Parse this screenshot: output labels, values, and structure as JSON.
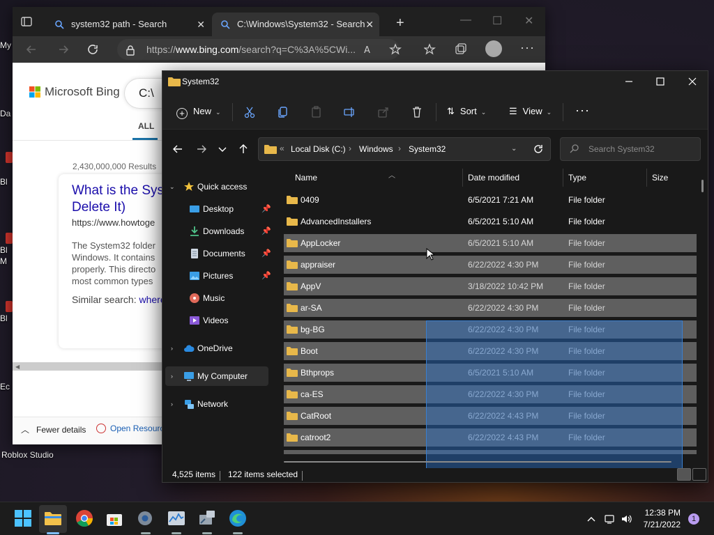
{
  "desktop": {
    "labels": [
      "My",
      "Da",
      "Bl",
      "Bl",
      "M",
      "Bl",
      "Ec",
      "Roblox Studio"
    ]
  },
  "browser": {
    "tabs": [
      {
        "title": "system32 path - Search",
        "active": false
      },
      {
        "title": "C:\\Windows\\System32 - Search",
        "active": true
      }
    ],
    "address_prefix": "https://",
    "address_domain": "www.bing.com",
    "address_rest": "/search?q=C%3A%5CWi...",
    "bing_name": "Microsoft Bing",
    "search_value": "C:\\",
    "tab_all": "ALL",
    "results_count": "2,430,000,000 Results",
    "result_title": "What is the Sys Delete It)",
    "result_url": "https://www.howtoge",
    "result_snippet": "The System32 folder Windows. It contains properly. This directo most common types",
    "similar_label": "Similar search:",
    "similar_link": "where",
    "fewer_details": "Fewer details",
    "open_resource": "Open Resourc"
  },
  "explorer": {
    "title": "System32",
    "commands": {
      "new": "New",
      "sort": "Sort",
      "view": "View"
    },
    "path": [
      "Local Disk (C:)",
      "Windows",
      "System32"
    ],
    "path_prefix": "«",
    "search_placeholder": "Search System32",
    "sidebar": {
      "quick_access": "Quick access",
      "items": [
        {
          "label": "Desktop",
          "icon": "desktop-icon",
          "pinned": true
        },
        {
          "label": "Downloads",
          "icon": "download-icon",
          "pinned": true
        },
        {
          "label": "Documents",
          "icon": "document-icon",
          "pinned": true
        },
        {
          "label": "Pictures",
          "icon": "pictures-icon",
          "pinned": true
        },
        {
          "label": "Music",
          "icon": "music-icon",
          "pinned": false
        },
        {
          "label": "Videos",
          "icon": "videos-icon",
          "pinned": false
        }
      ],
      "onedrive": "OneDrive",
      "my_computer": "My Computer",
      "network": "Network"
    },
    "columns": [
      "Name",
      "Date modified",
      "Type",
      "Size"
    ],
    "rows": [
      {
        "name": "0409",
        "date": "6/5/2021 7:21 AM",
        "type": "File folder",
        "selected": false
      },
      {
        "name": "AdvancedInstallers",
        "date": "6/5/2021 5:10 AM",
        "type": "File folder",
        "selected": false
      },
      {
        "name": "AppLocker",
        "date": "6/5/2021 5:10 AM",
        "type": "File folder",
        "selected": true
      },
      {
        "name": "appraiser",
        "date": "6/22/2022 4:30 PM",
        "type": "File folder",
        "selected": true
      },
      {
        "name": "AppV",
        "date": "3/18/2022 10:42 PM",
        "type": "File folder",
        "selected": true
      },
      {
        "name": "ar-SA",
        "date": "6/22/2022 4:30 PM",
        "type": "File folder",
        "selected": true
      },
      {
        "name": "bg-BG",
        "date": "6/22/2022 4:30 PM",
        "type": "File folder",
        "selected": true
      },
      {
        "name": "Boot",
        "date": "6/22/2022 4:30 PM",
        "type": "File folder",
        "selected": true
      },
      {
        "name": "Bthprops",
        "date": "6/5/2021 5:10 AM",
        "type": "File folder",
        "selected": true
      },
      {
        "name": "ca-ES",
        "date": "6/22/2022 4:30 PM",
        "type": "File folder",
        "selected": true
      },
      {
        "name": "CatRoot",
        "date": "6/22/2022 4:43 PM",
        "type": "File folder",
        "selected": true
      },
      {
        "name": "catroot2",
        "date": "6/22/2022 4:43 PM",
        "type": "File folder",
        "selected": true
      }
    ],
    "status": {
      "items": "4,525 items",
      "selected": "122 items selected"
    }
  },
  "taskbar": {
    "apps": [
      "start-icon",
      "file-explorer-icon",
      "chrome-icon",
      "store-icon",
      "settings-icon",
      "task-manager-icon",
      "tools-icon",
      "edge-icon"
    ],
    "time": "12:38 PM",
    "date": "7/21/2022",
    "notification_count": "1"
  },
  "colors": {
    "accent": "#0078d4",
    "folder": "#e8b84a",
    "selection": "#5f5f5f",
    "marquee": "#3a7fd0"
  }
}
